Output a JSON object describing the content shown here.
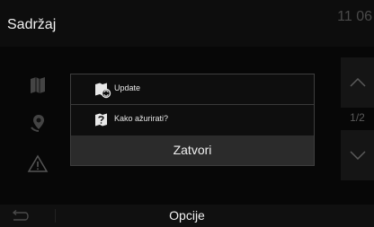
{
  "header": {
    "title": "Sadržaj",
    "clock": "11 06"
  },
  "sidebar": {
    "items": [
      {
        "icon": "map-book-icon"
      },
      {
        "icon": "location-pin-icon"
      },
      {
        "icon": "warning-triangle-icon"
      }
    ]
  },
  "popup": {
    "items": [
      {
        "label": "Update",
        "icon": "update-book-icon"
      },
      {
        "label": "Kako ažurirati?",
        "icon": "help-book-icon"
      }
    ],
    "close_label": "Zatvori"
  },
  "pager": {
    "indicator": "1/2",
    "up_icon": "chevron-up-icon",
    "down_icon": "chevron-down-icon"
  },
  "footer": {
    "back_icon": "back-arrow-icon",
    "options_label": "Opcije"
  }
}
